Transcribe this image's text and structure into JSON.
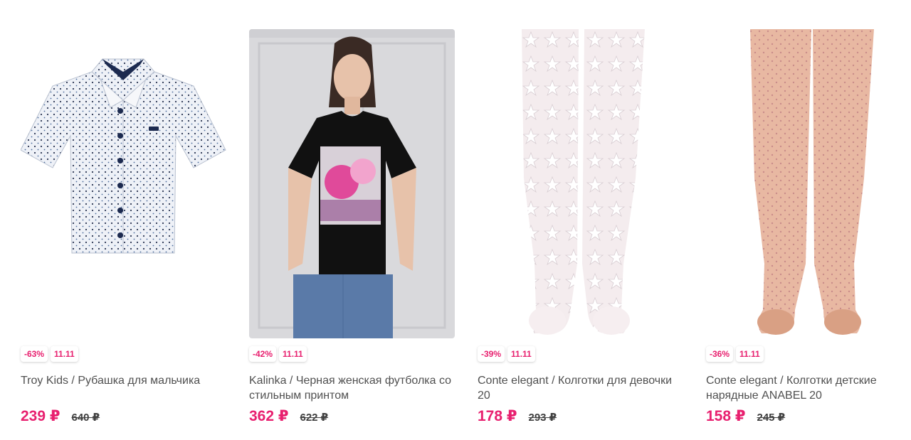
{
  "products": [
    {
      "brand": "Troy Kids",
      "name": "Рубашка для мальчика",
      "title": "Troy Kids / Рубашка для мальчика",
      "discount": "-63%",
      "tag": "11.11",
      "price": "239 ₽",
      "old_price": "640 ₽",
      "image_icon": "shirt-image"
    },
    {
      "brand": "Kalinka",
      "name": "Черная женская футболка со стильным принтом",
      "title": "Kalinka / Черная женская футболка со стильным принтом",
      "discount": "-42%",
      "tag": "11.11",
      "price": "362 ₽",
      "old_price": "622 ₽",
      "image_icon": "tshirt-model-image"
    },
    {
      "brand": "Conte elegant",
      "name": "Колготки для девочки 20",
      "title": "Conte elegant / Колготки для девочки 20",
      "discount": "-39%",
      "tag": "11.11",
      "price": "178 ₽",
      "old_price": "293 ₽",
      "image_icon": "white-tights-image"
    },
    {
      "brand": "Conte elegant",
      "name": "Колготки детские нарядные ANABEL 20",
      "title": "Conte elegant / Колготки детские нарядные ANABEL 20",
      "discount": "-36%",
      "tag": "11.11",
      "price": "158 ₽",
      "old_price": "245 ₽",
      "image_icon": "beige-tights-image"
    }
  ],
  "colors": {
    "accent": "#e8206f",
    "text": "#505050",
    "old_price": "#404040"
  }
}
